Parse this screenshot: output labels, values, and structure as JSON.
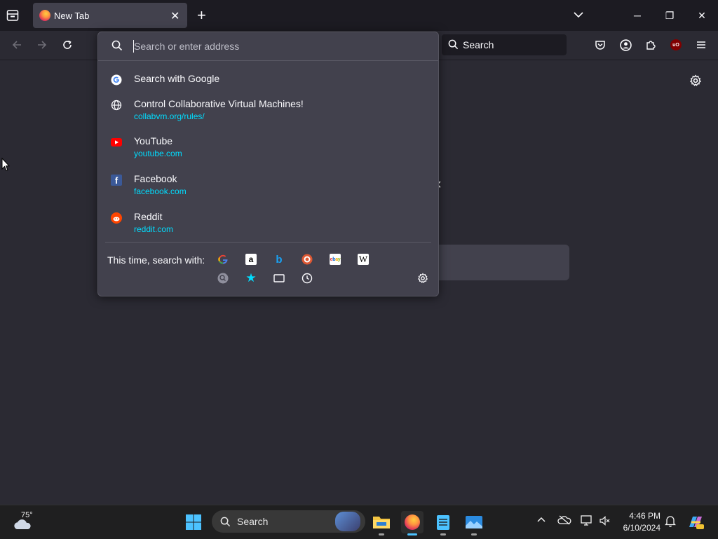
{
  "tab": {
    "title": "New Tab",
    "close": "✕"
  },
  "window": {
    "minimize": "─",
    "maximize": "❐",
    "close": "✕",
    "list_tabs": "⌄",
    "new_tab": "+"
  },
  "toolbar": {
    "search_label": "Search"
  },
  "urlbar": {
    "placeholder": "Search or enter address"
  },
  "suggestions": [
    {
      "title": "Search with Google",
      "url": ""
    },
    {
      "title": "Control Collaborative Virtual Machines!",
      "url": "collabvm.org/rules/"
    },
    {
      "title": "YouTube",
      "url": "youtube.com"
    },
    {
      "title": "Facebook",
      "url": "facebook.com"
    },
    {
      "title": "Reddit",
      "url": "reddit.com"
    }
  ],
  "one_off": {
    "label": "This time, search with:",
    "engines": [
      "google-icon",
      "amazon-icon",
      "bing-icon",
      "duckduckgo-icon",
      "ebay-icon",
      "wikipedia-icon"
    ],
    "modes": [
      "search-history-icon",
      "bookmarks-icon",
      "tabs-icon",
      "history-icon"
    ]
  },
  "taskbar": {
    "weather_temp": "75°",
    "search_label": "Search",
    "time": "4:46 PM",
    "date": "6/10/2024"
  },
  "colors": {
    "accent_url": "#00ddff",
    "popup_bg": "#42414d",
    "page_bg": "#2b2a33",
    "tabstrip_bg": "#1c1b22"
  }
}
